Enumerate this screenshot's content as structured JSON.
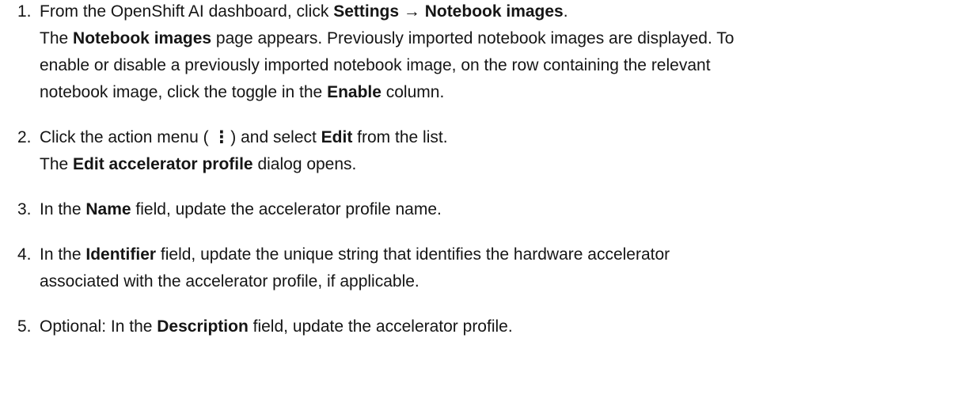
{
  "steps": [
    {
      "number": "1.",
      "lines": [
        [
          {
            "t": "From the OpenShift AI dashboard, click "
          },
          {
            "t": "Settings → Notebook images",
            "b": true
          },
          {
            "t": "."
          }
        ],
        [
          {
            "t": "The "
          },
          {
            "t": "Notebook images",
            "b": true
          },
          {
            "t": " page appears. Previously imported notebook images are displayed. To"
          }
        ],
        [
          {
            "t": "enable or disable a previously imported notebook image, on the row containing the relevant"
          }
        ],
        [
          {
            "t": "notebook image, click the toggle in the "
          },
          {
            "t": "Enable",
            "b": true
          },
          {
            "t": " column."
          }
        ]
      ]
    },
    {
      "number": "2.",
      "lines": [
        [
          {
            "t": "Click the action menu ( "
          },
          {
            "t": "⋮",
            "icon": "kebab-icon"
          },
          {
            "t": " ) and select "
          },
          {
            "t": "Edit",
            "b": true
          },
          {
            "t": " from the list."
          }
        ],
        [
          {
            "t": "The "
          },
          {
            "t": "Edit accelerator profile",
            "b": true
          },
          {
            "t": " dialog opens."
          }
        ]
      ]
    },
    {
      "number": "3.",
      "lines": [
        [
          {
            "t": "In the "
          },
          {
            "t": "Name",
            "b": true
          },
          {
            "t": " field, update the accelerator profile name."
          }
        ]
      ]
    },
    {
      "number": "4.",
      "lines": [
        [
          {
            "t": "In the "
          },
          {
            "t": "Identifier",
            "b": true
          },
          {
            "t": " field, update the unique string that identifies the hardware accelerator"
          }
        ],
        [
          {
            "t": "associated with the accelerator profile, if applicable."
          }
        ]
      ]
    },
    {
      "number": "5.",
      "lines": [
        [
          {
            "t": "Optional: In the "
          },
          {
            "t": "Description",
            "b": true
          },
          {
            "t": " field, update the accelerator profile."
          }
        ]
      ]
    }
  ]
}
